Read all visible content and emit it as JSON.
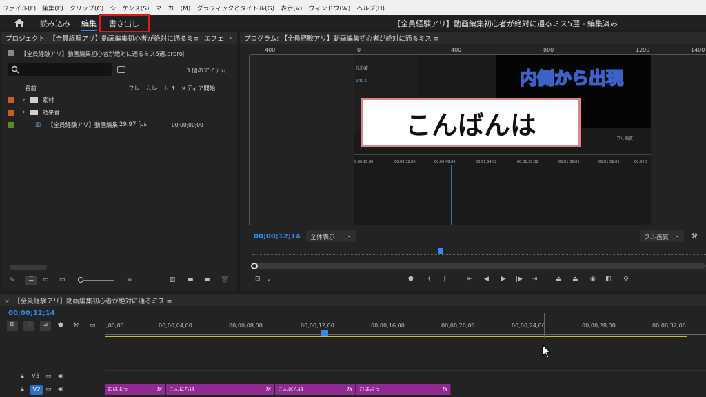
{
  "menu": [
    "ファイル(F)",
    "編集(E)",
    "クリップ(C)",
    "シーケンス(S)",
    "マーカー(M)",
    "グラフィックとタイトル(G)",
    "表示(V)",
    "ウィンドウ(W)",
    "ヘルプ(H)"
  ],
  "workspace": {
    "tabs": [
      "読み込み",
      "編集",
      "書き出し"
    ],
    "active_tab": "編集",
    "document_title": "【全員経験アリ】動画編集初心者が絶対に通るミス5選 - 編集済み"
  },
  "project_panel": {
    "header": "プロジェクト: 【全員経験アリ】動画編集初心者が絶対に通るミ≡",
    "effects_tab": "エフェ",
    "file_name": "【全員経験アリ】動画編集初心者が絶対に通るミス5選.prproj",
    "item_count": "3 個のアイテム",
    "columns": {
      "name": "名前",
      "framerate": "フレームレート ↑",
      "media_start": "メディア開始"
    },
    "items": [
      {
        "name": "素材",
        "color": "#c8611f",
        "type": "folder",
        "framerate": "",
        "media_start": ""
      },
      {
        "name": "効果音",
        "color": "#c8611f",
        "type": "folder",
        "framerate": "",
        "media_start": ""
      },
      {
        "name": "【全員経験アリ】動画編集",
        "color": "#5f8a1e",
        "type": "sequence",
        "framerate": "29.97 fps",
        "media_start": "00;00;00;00"
      }
    ]
  },
  "program_panel": {
    "header": "プログラム: 【全員経験アリ】動画編集初心者が絶対に通るミス ≡",
    "ruler_labels": [
      "400",
      "0",
      "400",
      "800",
      "1200",
      "1400"
    ],
    "overlay_text": "内側から出現",
    "title_card": "こんばんは",
    "timecode": "00;00;12;14",
    "fit": "全体表示",
    "quality": "フル画質",
    "inner": {
      "label1": "光彩度",
      "label2": "140.0",
      "quality": "フル画質",
      "timecodes": [
        "0;00;16;00",
        "00;00;32;00",
        "00;00;48;00",
        "00;01;04;02",
        "00;01;20;02",
        "00;01;36;02",
        "00;01;52;02",
        "00;02;0"
      ]
    }
  },
  "timeline": {
    "header": "【全員経験アリ】動画編集初心者が絶対に通るミス ≡",
    "timecode": "00;00;12;14",
    "ruler": [
      ";00;00",
      "00;00;04;00",
      "00;00;08;00",
      "00;00;12;00",
      "00;00;16;00",
      "00;00;20;00",
      "00;00;24;00",
      "00;00;28;00",
      "00;00;32;00"
    ],
    "tracks": [
      {
        "name": "V3"
      },
      {
        "name": "V2"
      }
    ],
    "clips": [
      {
        "label": "おはよう",
        "fx": "fx"
      },
      {
        "label": "こんにちは",
        "fx": "fx"
      },
      {
        "label": "こんばんは",
        "fx": "fx"
      },
      {
        "label": "おはよう",
        "fx": "fx"
      }
    ]
  },
  "colors": {
    "accent": "#2d8ceb",
    "highlight": "#e0191b",
    "clip": "#8f2a93",
    "panel": "#232323"
  }
}
